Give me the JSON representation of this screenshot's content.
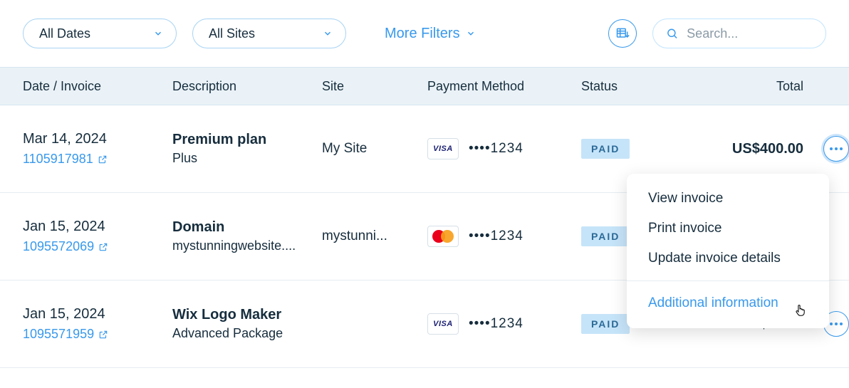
{
  "filters": {
    "dates_label": "All Dates",
    "sites_label": "All Sites",
    "more_filters_label": "More Filters"
  },
  "search": {
    "placeholder": "Search..."
  },
  "columns": {
    "date": "Date / Invoice",
    "description": "Description",
    "site": "Site",
    "payment": "Payment Method",
    "status": "Status",
    "total": "Total"
  },
  "status_labels": {
    "paid": "PAID"
  },
  "rows": [
    {
      "date": "Mar 14, 2024",
      "invoice_id": "1105917981",
      "desc_title": "Premium plan",
      "desc_sub": "Plus",
      "site": "My Site",
      "brand": "visa",
      "brand_label": "VISA",
      "mask": "••••1234",
      "status": "paid",
      "total": "US$400.00"
    },
    {
      "date": "Jan 15, 2024",
      "invoice_id": "1095572069",
      "desc_title": "Domain",
      "desc_sub": "mystunningwebsite....",
      "site": "mystunni...",
      "brand": "mastercard",
      "brand_label": "",
      "mask": "••••1234",
      "status": "paid",
      "total": ""
    },
    {
      "date": "Jan 15, 2024",
      "invoice_id": "1095571959",
      "desc_title": "Wix Logo Maker",
      "desc_sub": "Advanced Package",
      "site": "",
      "brand": "visa",
      "brand_label": "VISA",
      "mask": "••••1234",
      "status": "paid",
      "total": "US$50.00"
    }
  ],
  "popover": {
    "view": "View invoice",
    "print": "Print invoice",
    "update": "Update invoice details",
    "additional": "Additional information"
  }
}
